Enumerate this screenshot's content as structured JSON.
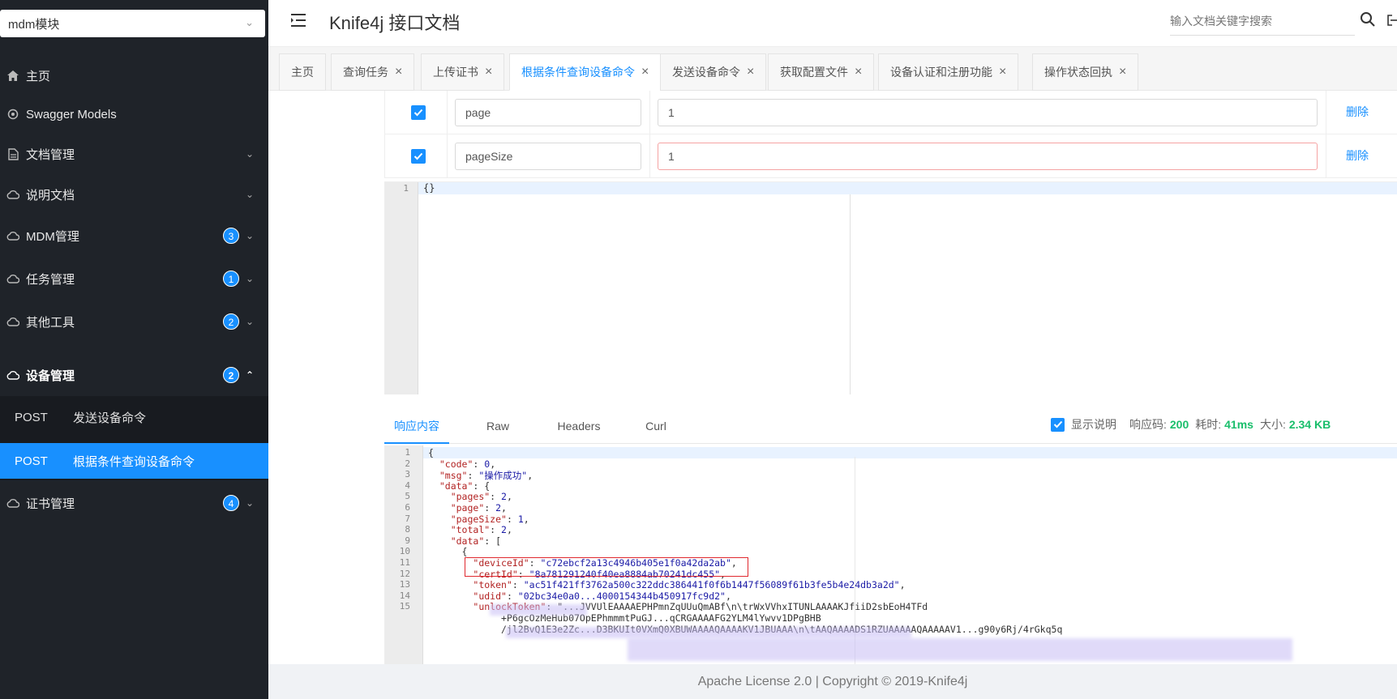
{
  "sidebar": {
    "module_select": "mdm模块",
    "items": [
      {
        "label": "主页",
        "icon": "home-icon"
      },
      {
        "label": "Swagger Models",
        "icon": "models-icon"
      },
      {
        "label": "文档管理",
        "icon": "doc-icon"
      },
      {
        "label": "说明文档",
        "icon": "cloud-icon"
      },
      {
        "label": "MDM管理",
        "icon": "cloud-icon",
        "badge": "3"
      },
      {
        "label": "任务管理",
        "icon": "cloud-icon",
        "badge": "1"
      },
      {
        "label": "其他工具",
        "icon": "cloud-icon",
        "badge": "2"
      },
      {
        "label": "设备管理",
        "icon": "cloud-icon",
        "badge": "2"
      },
      {
        "label": "证书管理",
        "icon": "cloud-icon",
        "badge": "4"
      }
    ],
    "sub_items": [
      {
        "method": "POST",
        "label": "发送设备命令"
      },
      {
        "method": "POST",
        "label": "根据条件查询设备命令"
      }
    ]
  },
  "header": {
    "title": "Knife4j 接口文档",
    "search_placeholder": "输入文档关键字搜索"
  },
  "tabs": [
    {
      "label": "主页"
    },
    {
      "label": "查询任务"
    },
    {
      "label": "上传证书"
    },
    {
      "label": "根据条件查询设备命令"
    },
    {
      "label": "发送设备命令"
    },
    {
      "label": "获取配置文件"
    },
    {
      "label": "设备认证和注册功能"
    },
    {
      "label": "操作状态回执"
    }
  ],
  "params": [
    {
      "name": "page",
      "value": "1",
      "action": "删除"
    },
    {
      "name": "pageSize",
      "value": "1",
      "action": "删除"
    }
  ],
  "request_editor": {
    "line": "1",
    "content": "{}"
  },
  "response": {
    "tabs": [
      "响应内容",
      "Raw",
      "Headers",
      "Curl"
    ],
    "show_desc_label": "显示说明",
    "code_label": "响应码:",
    "code": "200",
    "time_label": "耗时:",
    "time": "41ms",
    "size_label": "大小:",
    "size": "2.34 KB"
  },
  "json_lines": [
    "{",
    "  \"code\": 0,",
    "  \"msg\": \"操作成功\",",
    "  \"data\": {",
    "    \"pages\": 2,",
    "    \"page\": 2,",
    "    \"pageSize\": 1,",
    "    \"total\": 2,",
    "    \"data\": [",
    "      {",
    "        \"deviceId\": \"c72ebcf2a13c4946b405e1f0a42da2ab\",",
    "        \"certId\": \"8a781291240f40ea8884ab70241dc455\",",
    "        \"token\": \"ac51f421ff3762a500c322ddc386441f0f6b1447f56089f61b3fe5b4e24db3a2d\",",
    "        \"udid\": \"02bc34e0a0...4000154344b450917fc9d2\",",
    "        \"unlockToken\": \"...JVVUlEAAAAEPHPmnZqUUuQmABf\\n\\trWxVVhxITUNLAAAAKJfiiD2sbEoH4TFd",
    "             +P6gcOzMeHub07OpEPhmmmtPuGJ...qCRGAAAAFG2YLM4lYwvv1DPgBHB",
    "             /jl2BvQ1E3e2Zc...D3BKUIt0VXmQ0XBUWAAAAQAAAAKV1JBUAAA\\n\\tAAQAAAADS1RZUAAAAAQAAAAAV1...g90y6Rj/4rGkq5q"
  ],
  "json_line_numbers": [
    "1",
    "2",
    "3",
    "4",
    "5",
    "6",
    "7",
    "8",
    "9",
    "10",
    "11",
    "12",
    "13",
    "14",
    "15",
    "",
    ""
  ],
  "footer": "Apache License 2.0 | Copyright © 2019-Knife4j"
}
